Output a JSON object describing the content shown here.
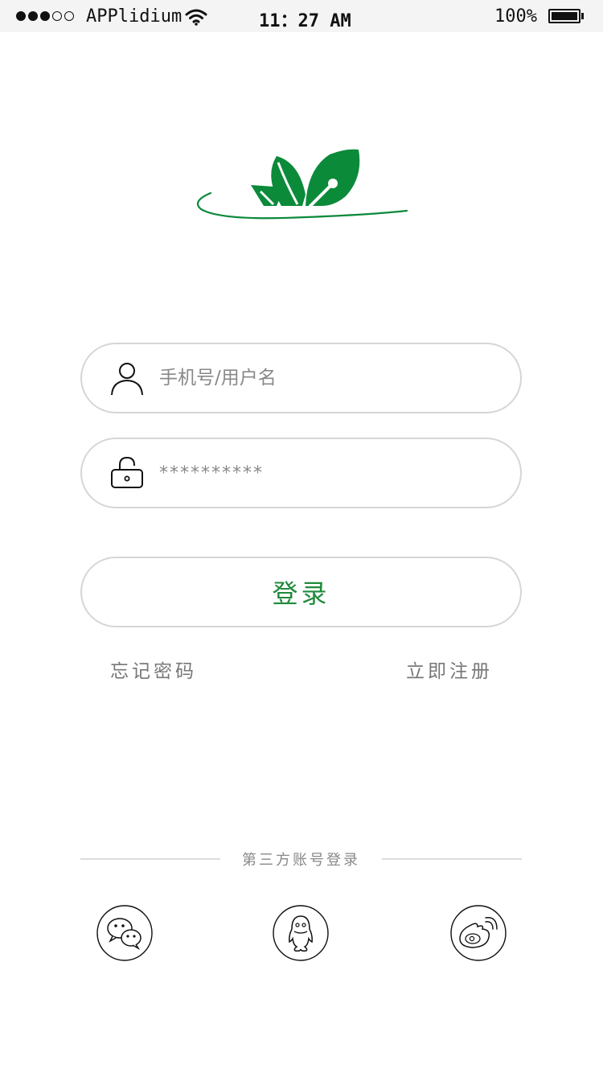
{
  "status_bar": {
    "carrier": "APPlidium",
    "time": "11：27 AM",
    "battery": "100%",
    "signal_bars_filled": 3,
    "signal_bars_total": 5
  },
  "logo": {
    "icon": "sprout-leaves-logo",
    "color": "#0b8a3a"
  },
  "login_form": {
    "username": {
      "icon": "user-icon",
      "placeholder": "手机号/用户名",
      "value": ""
    },
    "password": {
      "icon": "lock-icon",
      "placeholder": "**********",
      "value": ""
    },
    "submit_label": "登录"
  },
  "links": {
    "forgot_password": "忘记密码",
    "register": "立即注册"
  },
  "third_party": {
    "title": "第三方账号登录",
    "providers": [
      {
        "name": "wechat",
        "icon": "wechat-icon"
      },
      {
        "name": "qq",
        "icon": "qq-icon"
      },
      {
        "name": "weibo",
        "icon": "weibo-icon"
      }
    ]
  },
  "colors": {
    "accent": "#1f8a3c",
    "border": "#d6d6d6",
    "muted_text": "#777777"
  }
}
